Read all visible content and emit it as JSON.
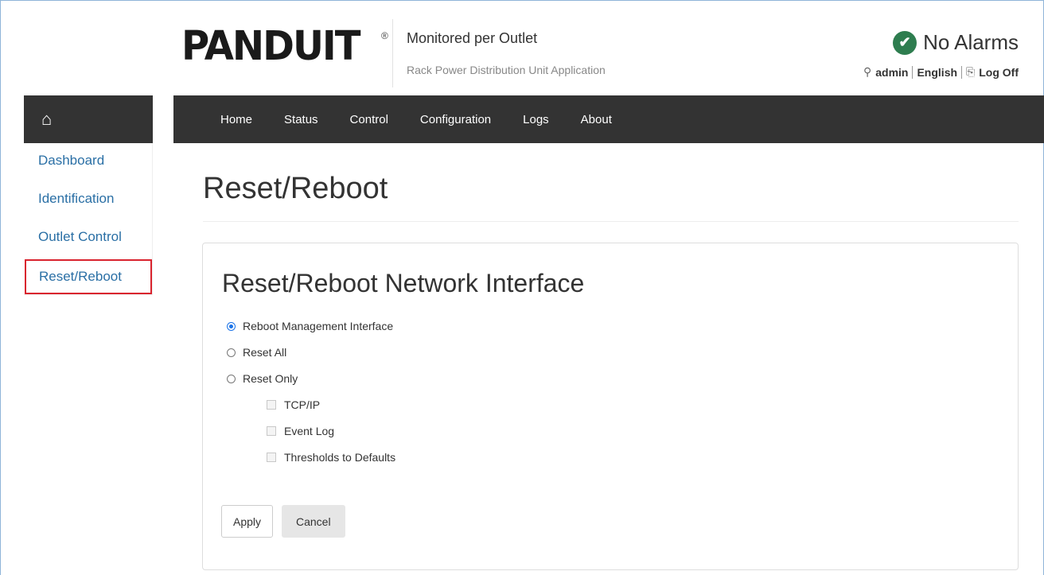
{
  "header": {
    "logo_text": "PANDUIT",
    "logo_reg": "®",
    "app_title": "Monitored per Outlet",
    "app_subtitle": "Rack Power Distribution Unit Application",
    "alarm_text": "No Alarms",
    "user": "admin",
    "language": "English",
    "logoff": "Log Off"
  },
  "topnav": {
    "items": [
      "Home",
      "Status",
      "Control",
      "Configuration",
      "Logs",
      "About"
    ]
  },
  "sidebar": {
    "home_icon": "home-icon",
    "items": [
      {
        "label": "Dashboard"
      },
      {
        "label": "Identification"
      },
      {
        "label": "Outlet Control"
      },
      {
        "label": "Reset/Reboot",
        "active": true
      }
    ]
  },
  "main": {
    "page_title": "Reset/Reboot",
    "panel_title": "Reset/Reboot Network Interface",
    "options": [
      {
        "label": "Reboot Management Interface",
        "selected": true
      },
      {
        "label": "Reset All",
        "selected": false
      },
      {
        "label": "Reset Only",
        "selected": false
      }
    ],
    "suboptions": [
      {
        "label": "TCP/IP",
        "checked": false,
        "disabled": true
      },
      {
        "label": "Event Log",
        "checked": false,
        "disabled": true
      },
      {
        "label": "Thresholds to Defaults",
        "checked": false,
        "disabled": true
      }
    ],
    "apply_label": "Apply",
    "cancel_label": "Cancel"
  },
  "colors": {
    "nav_bg": "#333333",
    "link": "#2a6fa5",
    "active_border": "#d9232e",
    "alarm_ok": "#2e7d4f"
  }
}
